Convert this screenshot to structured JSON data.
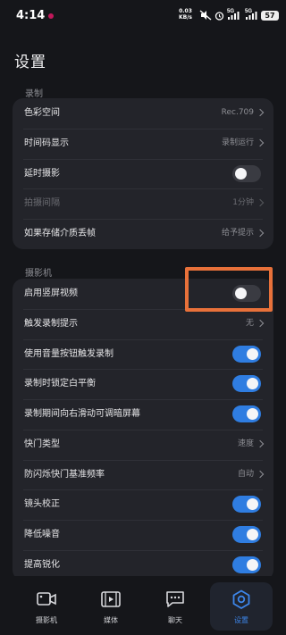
{
  "status_bar": {
    "time": "4:14",
    "net_speed": "0.03",
    "net_unit": "KB/s",
    "sig1": "5G",
    "sig2": "5G",
    "battery": "57",
    "icons": [
      "mute-icon",
      "alarm-icon",
      "signal-icon",
      "signal-icon",
      "battery-icon"
    ]
  },
  "page": {
    "title": "设置"
  },
  "sections": {
    "record": {
      "header": "录制",
      "rows": [
        {
          "label": "色彩空间",
          "value": "Rec.709"
        },
        {
          "label": "时间码显示",
          "value": "录制运行"
        },
        {
          "label": "延时摄影"
        },
        {
          "label": "拍摄间隔",
          "value": "1分钟"
        },
        {
          "label": "如果存储介质丢帧",
          "value": "给予提示"
        }
      ]
    },
    "camera": {
      "header": "摄影机",
      "rows": [
        {
          "label": "启用竖屏视频"
        },
        {
          "label": "触发录制提示",
          "value": "无"
        },
        {
          "label": "使用音量按钮触发录制"
        },
        {
          "label": "录制时锁定白平衡"
        },
        {
          "label": "录制期间向右滑动可调暗屏幕"
        },
        {
          "label": "快门类型",
          "value": "速度"
        },
        {
          "label": "防闪烁快门基准频率",
          "value": "自动"
        },
        {
          "label": "镜头校正"
        },
        {
          "label": "降低噪音"
        },
        {
          "label": "提高锐化"
        }
      ]
    }
  },
  "toggles": {
    "timelapse": false,
    "portrait_video": false,
    "volume_record": true,
    "lock_wb": true,
    "swipe_dim": true,
    "lens_correction": true,
    "noise_reduction": true,
    "sharpen": true
  },
  "bottom_nav": [
    {
      "label": "摄影机",
      "icon": "camera-icon",
      "active": false
    },
    {
      "label": "媒体",
      "icon": "film-icon",
      "active": false
    },
    {
      "label": "聊天",
      "icon": "chat-icon",
      "active": false
    },
    {
      "label": "设置",
      "icon": "gear-icon",
      "active": true
    }
  ],
  "colors": {
    "accent": "#2f7de1",
    "highlight": "#e8713a",
    "background": "#15161a",
    "card": "#23242a"
  }
}
